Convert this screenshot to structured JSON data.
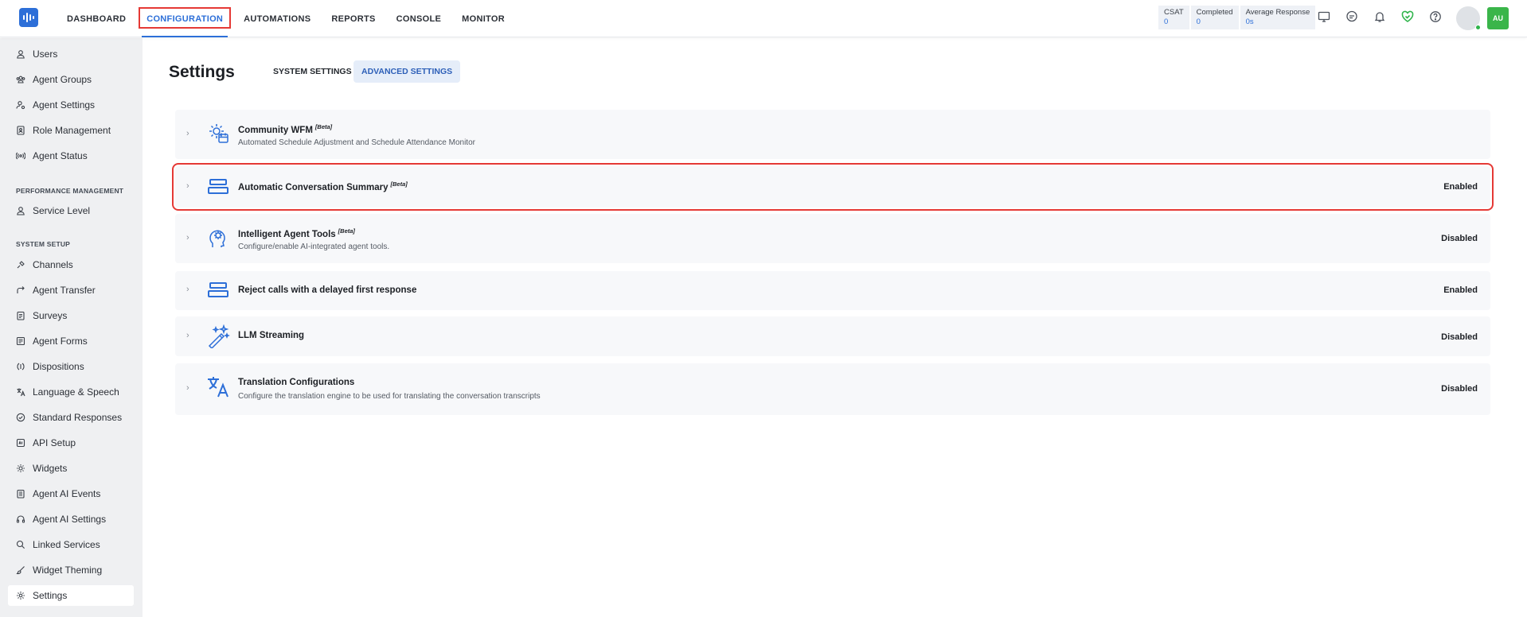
{
  "nav": {
    "items": [
      "DASHBOARD",
      "CONFIGURATION",
      "AUTOMATIONS",
      "REPORTS",
      "CONSOLE",
      "MONITOR"
    ],
    "active": "CONFIGURATION"
  },
  "stats": [
    {
      "label": "CSAT",
      "value": "0"
    },
    {
      "label": "Completed",
      "value": "0"
    },
    {
      "label": "Average Response",
      "value": "0s"
    }
  ],
  "top_icons": [
    "monitor-icon",
    "chat-icon",
    "bell-icon",
    "heart-check-icon",
    "help-icon"
  ],
  "user": {
    "initials": "AU",
    "status_color": "#2fb44b"
  },
  "sidebar": {
    "group1": [
      {
        "label": "Users",
        "icon": "user-icon"
      },
      {
        "label": "Agent Groups",
        "icon": "group-icon"
      },
      {
        "label": "Agent Settings",
        "icon": "user-settings-icon"
      },
      {
        "label": "Role Management",
        "icon": "role-icon"
      },
      {
        "label": "Agent Status",
        "icon": "broadcast-icon"
      }
    ],
    "performance_heading": "PERFORMANCE MANAGEMENT",
    "group2": [
      {
        "label": "Service Level",
        "icon": "user-icon"
      }
    ],
    "system_heading": "SYSTEM SETUP",
    "group3": [
      {
        "label": "Channels",
        "icon": "channels-icon"
      },
      {
        "label": "Agent Transfer",
        "icon": "transfer-icon"
      },
      {
        "label": "Surveys",
        "icon": "survey-icon"
      },
      {
        "label": "Agent Forms",
        "icon": "form-icon"
      },
      {
        "label": "Dispositions",
        "icon": "disposition-icon"
      },
      {
        "label": "Language & Speech",
        "icon": "language-icon"
      },
      {
        "label": "Standard Responses",
        "icon": "check-circle-icon"
      },
      {
        "label": "API Setup",
        "icon": "api-icon"
      },
      {
        "label": "Widgets",
        "icon": "widget-icon"
      },
      {
        "label": "Agent AI Events",
        "icon": "events-icon"
      },
      {
        "label": "Agent AI Settings",
        "icon": "headset-icon"
      },
      {
        "label": "Linked Services",
        "icon": "search-icon"
      },
      {
        "label": "Widget Theming",
        "icon": "brush-icon"
      },
      {
        "label": "Settings",
        "icon": "gear-icon"
      }
    ],
    "active": "Settings"
  },
  "page": {
    "title": "Settings",
    "tabs": [
      "SYSTEM SETTINGS",
      "ADVANCED SETTINGS"
    ],
    "active_tab": "ADVANCED SETTINGS"
  },
  "settings": [
    {
      "title": "Community WFM",
      "badge": "[Beta]",
      "description": "Automated Schedule Adjustment and Schedule Attendance Monitor",
      "status": "",
      "icon": "calendar-gear-icon"
    },
    {
      "title": "Automatic Conversation Summary",
      "badge": "[Beta]",
      "description": "",
      "status": "Enabled",
      "icon": "summary-icon"
    },
    {
      "title": "Intelligent Agent Tools",
      "badge": "[Beta]",
      "description": "Configure/enable AI-integrated agent tools.",
      "status": "Disabled",
      "icon": "ai-head-icon"
    },
    {
      "title": "Reject calls with a delayed first response",
      "badge": "",
      "description": "",
      "status": "Enabled",
      "icon": "summary-icon"
    },
    {
      "title": "LLM Streaming",
      "badge": "",
      "description": "",
      "status": "Disabled",
      "icon": "magic-wand-icon"
    },
    {
      "title": "Translation Configurations",
      "badge": "",
      "description": "Configure the translation engine to be used for translating the conversation transcripts",
      "status": "Disabled",
      "icon": "translate-icon"
    }
  ],
  "colors": {
    "accent": "#2d6fd8",
    "highlight": "#e53935",
    "sidebar_bg": "#eff0f2",
    "card_bg": "#f7f8fa"
  }
}
